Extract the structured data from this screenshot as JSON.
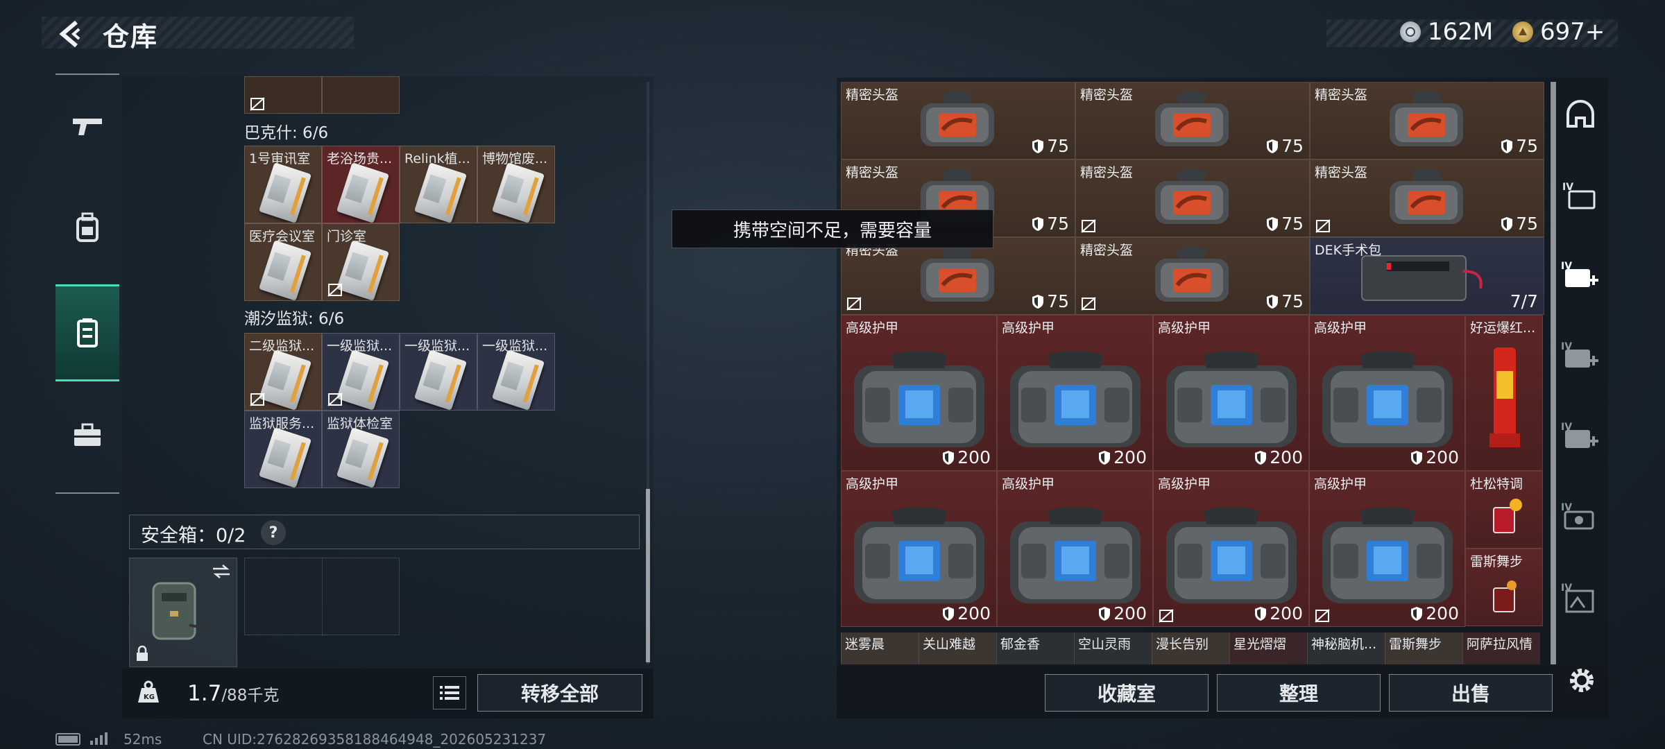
{
  "header": {
    "title": "仓库",
    "currency": [
      {
        "icon": "silver-coin-icon",
        "value": "162M"
      },
      {
        "icon": "gold-coin-icon",
        "value": "697+"
      }
    ]
  },
  "left_nav": {
    "items": [
      {
        "icon": "gun-icon",
        "active": false
      },
      {
        "icon": "backpack-icon",
        "active": false
      },
      {
        "icon": "locker-icon",
        "active": true
      },
      {
        "icon": "toolbox-icon",
        "active": false
      }
    ]
  },
  "key_groups": [
    {
      "title": "巴克什: 6/6",
      "cards": [
        {
          "label": "1号审讯室",
          "bg": "brown",
          "nodrop": false
        },
        {
          "label": "老浴场贵...",
          "bg": "red",
          "nodrop": false
        },
        {
          "label": "Relink植...",
          "bg": "brown",
          "nodrop": false
        },
        {
          "label": "博物馆废...",
          "bg": "brown",
          "nodrop": false
        },
        {
          "label": "医疗会议室",
          "bg": "brown",
          "nodrop": false
        },
        {
          "label": "门诊室",
          "bg": "brown",
          "nodrop": true
        }
      ]
    },
    {
      "title": "潮汐监狱: 6/6",
      "cards": [
        {
          "label": "二级监狱...",
          "bg": "brown",
          "nodrop": true
        },
        {
          "label": "一级监狱...",
          "bg": "purple",
          "nodrop": true
        },
        {
          "label": "一级监狱...",
          "bg": "purple",
          "nodrop": false
        },
        {
          "label": "一级监狱...",
          "bg": "purple",
          "nodrop": false
        },
        {
          "label": "监狱服务...",
          "bg": "purple",
          "nodrop": false
        },
        {
          "label": "监狱体检室",
          "bg": "purple",
          "nodrop": false
        }
      ]
    }
  ],
  "safebox": {
    "label": "安全箱：0/2",
    "help": "?"
  },
  "weight": {
    "current": "1.7",
    "max": "/88千克"
  },
  "buttons": {
    "transfer_all": "转移全部",
    "collection_room": "收藏室",
    "organize": "整理",
    "sell": "出售"
  },
  "tooltip": "携带空间不足，需要容量",
  "helmets": [
    {
      "name": "精密头盔",
      "durability": "75",
      "nodrop": false
    },
    {
      "name": "精密头盔",
      "durability": "75",
      "nodrop": false
    },
    {
      "name": "精密头盔",
      "durability": "75",
      "nodrop": false
    },
    {
      "name": "精密头盔",
      "durability": "75",
      "nodrop": false
    },
    {
      "name": "精密头盔",
      "durability": "75",
      "nodrop": true
    },
    {
      "name": "精密头盔",
      "durability": "75",
      "nodrop": true
    },
    {
      "name": "精密头盔",
      "durability": "75",
      "nodrop": true
    },
    {
      "name": "精密头盔",
      "durability": "75",
      "nodrop": true
    }
  ],
  "medkit": {
    "name": "DEK手术包",
    "count": "7/7"
  },
  "armors": [
    {
      "name": "高级护甲",
      "durability": "200",
      "nodrop": false
    },
    {
      "name": "高级护甲",
      "durability": "200",
      "nodrop": false
    },
    {
      "name": "高级护甲",
      "durability": "200",
      "nodrop": false
    },
    {
      "name": "高级护甲",
      "durability": "200",
      "nodrop": false
    },
    {
      "name": "高级护甲",
      "durability": "200",
      "nodrop": false
    },
    {
      "name": "高级护甲",
      "durability": "200",
      "nodrop": false
    },
    {
      "name": "高级护甲",
      "durability": "200",
      "nodrop": true
    },
    {
      "name": "高级护甲",
      "durability": "200",
      "nodrop": true
    }
  ],
  "side_items": [
    {
      "name": "好运爆红..."
    },
    {
      "name": "杜松特调"
    },
    {
      "name": "雷斯舞步"
    }
  ],
  "bottom_items": [
    "迷雾晨",
    "关山难越",
    "郁金香",
    "空山灵雨",
    "漫长告别",
    "星光熠熠",
    "神秘脑机...",
    "雷斯舞步",
    "阿萨拉风情"
  ],
  "right_rail": [
    "helmet-slot-icon",
    "card-iv-icon",
    "add-iv-active-icon",
    "add-iv-icon",
    "add-iv-icon",
    "ticket-iv-icon",
    "frame-iv-icon"
  ],
  "status": {
    "ping": "52ms",
    "uid": "CN UID:2762826935818846494​8_202605231237"
  },
  "colors": {
    "accent": "#46e0b4",
    "brown_cell": "#4a382c",
    "red_cell": "#5c2627",
    "purple_cell": "#2e3245"
  }
}
